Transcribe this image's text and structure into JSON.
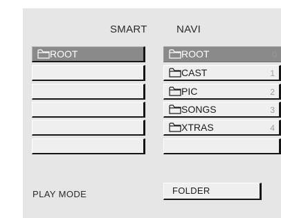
{
  "header": {
    "title_left": "SMART",
    "title_right": "NAVI"
  },
  "left_list": {
    "items": [
      {
        "label": "ROOT",
        "icon": "folder-icon",
        "selected": true
      },
      {
        "label": ""
      },
      {
        "label": ""
      },
      {
        "label": ""
      },
      {
        "label": ""
      },
      {
        "label": ""
      }
    ]
  },
  "right_list": {
    "items": [
      {
        "label": "ROOT",
        "index": "0",
        "icon": "folder-icon",
        "selected": true
      },
      {
        "label": "CAST",
        "index": "1",
        "icon": "folder-icon"
      },
      {
        "label": "PIC",
        "index": "2",
        "icon": "folder-icon"
      },
      {
        "label": "SONGS",
        "index": "3",
        "icon": "folder-icon"
      },
      {
        "label": "XTRAS",
        "index": "4",
        "icon": "folder-icon"
      },
      {
        "label": ""
      }
    ]
  },
  "footer": {
    "play_mode_label": "PLAY MODE",
    "play_mode_value": "FOLDER"
  },
  "colors": {
    "panel_bg": "#e6e6e6",
    "slot_bg": "#efefef",
    "selected_bg": "#8a8a8a",
    "index_text": "#9c9c9c"
  }
}
